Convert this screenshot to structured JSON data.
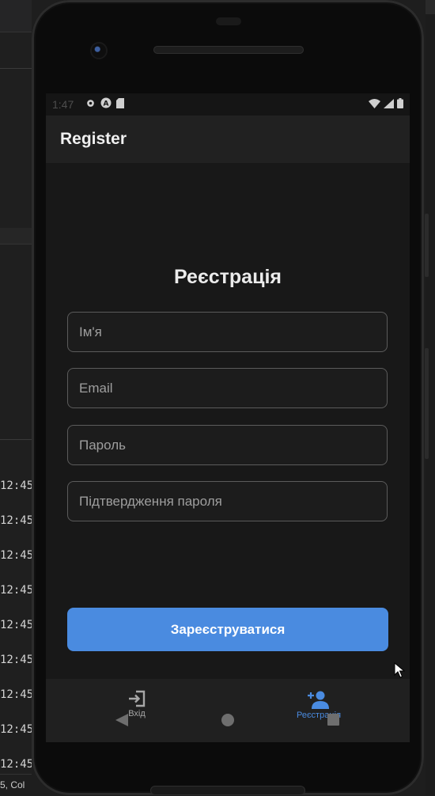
{
  "ide": {
    "times": [
      "12:45",
      "12:45",
      "12:45",
      "12:45",
      "12:45",
      "12:45",
      "12:45",
      "12:45",
      "12:45"
    ],
    "status_text": "5, Col"
  },
  "status_bar": {
    "time": "1:47"
  },
  "app_bar": {
    "title": "Register"
  },
  "form": {
    "heading": "Реєстрація",
    "name_placeholder": "Ім'я",
    "email_placeholder": "Email",
    "password_placeholder": "Пароль",
    "confirm_placeholder": "Підтвердження пароля",
    "submit_label": "Зареєструватися"
  },
  "bottom_nav": {
    "items": [
      {
        "label": "Вхід",
        "icon": "login-icon",
        "active": false
      },
      {
        "label": "Реєстрація",
        "icon": "person-add-icon",
        "active": true
      }
    ]
  },
  "colors": {
    "accent": "#4a8be0",
    "background": "#181818",
    "app_bar": "#212121",
    "field_border": "#5b5b5b"
  }
}
